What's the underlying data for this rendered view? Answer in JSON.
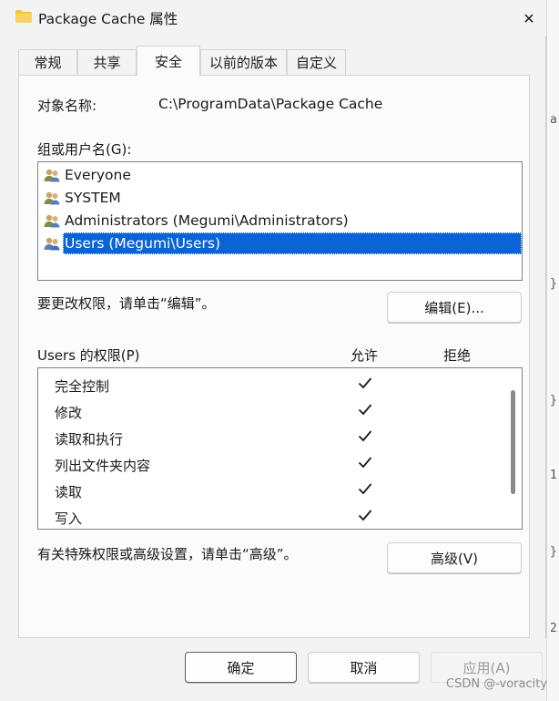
{
  "window": {
    "title": "Package Cache 属性",
    "close_glyph": "✕"
  },
  "tabs": [
    {
      "label": "常规",
      "active": false
    },
    {
      "label": "共享",
      "active": false
    },
    {
      "label": "安全",
      "active": true
    },
    {
      "label": "以前的版本",
      "active": false
    },
    {
      "label": "自定义",
      "active": false
    }
  ],
  "security": {
    "object_name_label": "对象名称:",
    "object_name_value": "C:\\ProgramData\\Package Cache",
    "groups_label": "组或用户名(G):",
    "users": [
      {
        "name": "Everyone",
        "selected": false
      },
      {
        "name": "SYSTEM",
        "selected": false
      },
      {
        "name": "Administrators (Megumi\\Administrators)",
        "selected": false
      },
      {
        "name": "Users (Megumi\\Users)",
        "selected": true
      }
    ],
    "edit_hint": "要更改权限，请单击“编辑”。",
    "edit_button": "编辑(E)...",
    "permissions_label": "Users 的权限(P)",
    "allow_header": "允许",
    "deny_header": "拒绝",
    "permissions": [
      {
        "name": "完全控制",
        "allow": true,
        "deny": false
      },
      {
        "name": "修改",
        "allow": true,
        "deny": false
      },
      {
        "name": "读取和执行",
        "allow": true,
        "deny": false
      },
      {
        "name": "列出文件夹内容",
        "allow": true,
        "deny": false
      },
      {
        "name": "读取",
        "allow": true,
        "deny": false
      },
      {
        "name": "写入",
        "allow": true,
        "deny": false
      }
    ],
    "advanced_hint": "有关特殊权限或高级设置，请单击“高级”。",
    "advanced_button": "高级(V)"
  },
  "footer": {
    "ok": "确定",
    "cancel": "取消",
    "apply": "应用(A)"
  },
  "watermark": "CSDN @-voracity",
  "background_window": {
    "fragments": [
      "a",
      "}",
      "}",
      "1",
      "}",
      "2"
    ]
  },
  "colors": {
    "selection": "#0a64d6",
    "panel_bg": "#fbfbfb",
    "dialog_bg": "#f3f3f3",
    "folder": "#f5c242"
  }
}
